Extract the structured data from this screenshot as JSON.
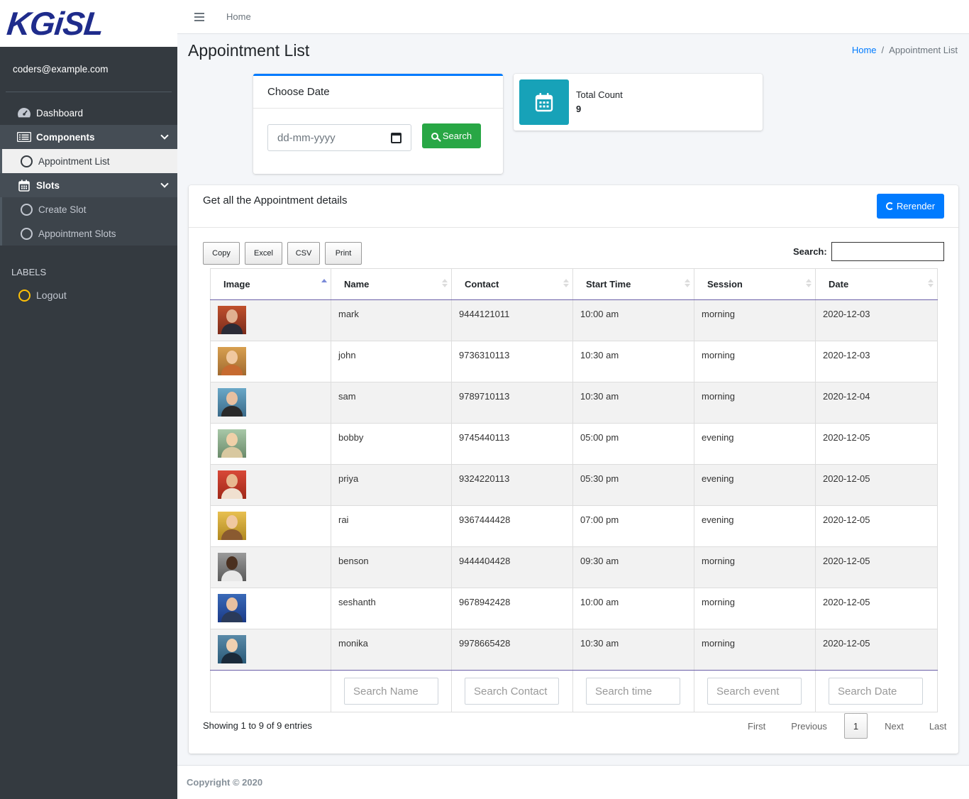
{
  "brand": {
    "logo_text": "KGiSL"
  },
  "user": {
    "email": "coders@example.com"
  },
  "sidebar": {
    "dashboard": "Dashboard",
    "components": "Components",
    "appointment_list": "Appointment List",
    "slots": "Slots",
    "create_slot": "Create Slot",
    "appointment_slots": "Appointment Slots",
    "labels_header": "LABELS",
    "logout": "Logout"
  },
  "topbar": {
    "home": "Home"
  },
  "header": {
    "title": "Appointment List",
    "breadcrumb": {
      "home": "Home",
      "current": "Appointment List"
    }
  },
  "date_card": {
    "title": "Choose Date",
    "placeholder": "dd-mm-yyyy",
    "search_button": "Search"
  },
  "info_box": {
    "label": "Total Count",
    "count": "9",
    "accent_color": "#17a2b8"
  },
  "main_card": {
    "title": "Get all the Appointment details",
    "rerender_button": "Rerender",
    "export_buttons": [
      "Copy",
      "Excel",
      "CSV",
      "Print"
    ],
    "search_label": "Search:",
    "columns": [
      "Image",
      "Name",
      "Contact",
      "Start Time",
      "Session",
      "Date"
    ],
    "rows": [
      {
        "name": "mark",
        "contact": "9444121011",
        "start_time": "10:00 am",
        "session": "morning",
        "date": "2020-12-03"
      },
      {
        "name": "john",
        "contact": "9736310113",
        "start_time": "10:30 am",
        "session": "morning",
        "date": "2020-12-03"
      },
      {
        "name": "sam",
        "contact": "9789710113",
        "start_time": "10:30 am",
        "session": "morning",
        "date": "2020-12-04"
      },
      {
        "name": "bobby",
        "contact": "9745440113",
        "start_time": "05:00 pm",
        "session": "evening",
        "date": "2020-12-05"
      },
      {
        "name": "priya",
        "contact": "9324220113",
        "start_time": "05:30 pm",
        "session": "evening",
        "date": "2020-12-05"
      },
      {
        "name": "rai",
        "contact": "9367444428",
        "start_time": "07:00 pm",
        "session": "evening",
        "date": "2020-12-05"
      },
      {
        "name": "benson",
        "contact": "9444404428",
        "start_time": "09:30 am",
        "session": "morning",
        "date": "2020-12-05"
      },
      {
        "name": "seshanth",
        "contact": "9678942428",
        "start_time": "10:00 am",
        "session": "morning",
        "date": "2020-12-05"
      },
      {
        "name": "monika",
        "contact": "9978665428",
        "start_time": "10:30 am",
        "session": "morning",
        "date": "2020-12-05"
      }
    ],
    "footer_placeholders": [
      "Search Name",
      "Search Contact",
      "Search time",
      "Search event",
      "Search Date"
    ],
    "info": "Showing 1 to 9 of 9 entries",
    "pagination": {
      "first": "First",
      "previous": "Previous",
      "current": "1",
      "next": "Next",
      "last": "Last"
    }
  },
  "footer": {
    "copyright": "Copyright © 2020"
  },
  "colors": {
    "primary": "#007bff",
    "success": "#28a745",
    "info": "#17a2b8",
    "sidebar": "#343a40"
  }
}
